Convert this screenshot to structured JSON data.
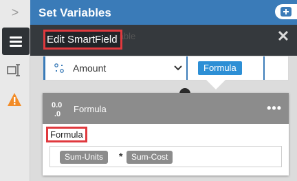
{
  "rail": {
    "expand_glyph": ">",
    "icons": [
      "list-icon",
      "field-input-icon",
      "warning-icon"
    ]
  },
  "header": {
    "title": "Set Variables",
    "add_icon": "add-icon"
  },
  "overlay": {
    "ghost_title": "...ts - Variable",
    "edit_label": "Edit SmartField",
    "close_glyph": "✕"
  },
  "variable_row": {
    "field_name": "Amount",
    "value_type": "Formula"
  },
  "formula_card": {
    "title": "Formula",
    "more_glyph": "•••",
    "section_label": "Formula",
    "expression": {
      "left": "Sum-Units",
      "operator": "*",
      "right": "Sum-Cost"
    }
  },
  "colors": {
    "header_blue": "#3a7bb8",
    "badge_blue": "#2d8fd5",
    "highlight_red": "#e0393e",
    "card_gray": "#8c8c8c",
    "warning_orange": "#f28c28"
  }
}
